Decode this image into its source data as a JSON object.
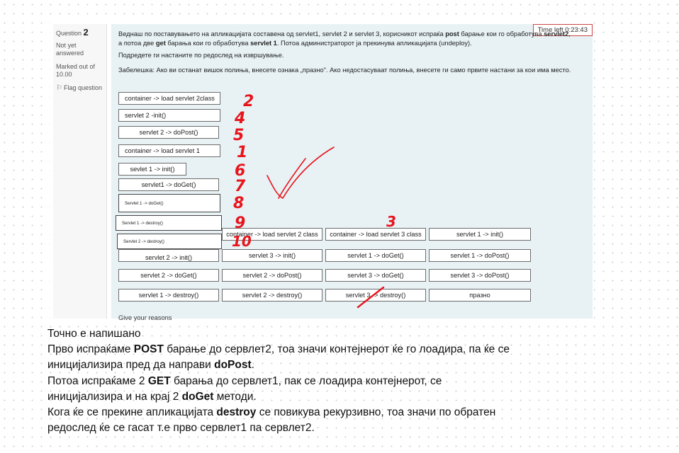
{
  "question": {
    "label": "Question",
    "number": "2",
    "status": "Not yet answered",
    "marked": "Marked out of 10.00",
    "flag": "Flag question",
    "timer": "Time left 0:23:43",
    "text1_a": "Веднаш по поставувањето на апликацијата составена од servlet1, servlet 2 и servlet 3, корисникот испраќа ",
    "text1_b": "post",
    "text1_c": " барање кои го обработува ",
    "text1_d": "servlet2",
    "text1_e": ", а потоа две ",
    "text1_f": "get",
    "text1_g": " барања кои го обработува ",
    "text1_h": "servlet 1",
    "text1_i": ". Потоа администраторот ја прекинува апликацијата (undeploy).",
    "text2": "Подредете ги настаните по редослед на извршување.",
    "text3": "Забелешка: Ако ви останат вишок полиња, внесете ознака „празно\". Ако недостасуваат полиња, внесете ги само првите настани за кои има место.",
    "give_reasons": "Give your reasons"
  },
  "order_slots": [
    "container -> load servlet 2class",
    "servlet 2 -init()",
    "servlet 2 -> doPost()",
    "container -> load servlet 1",
    "sevlet 1 -> init()",
    "servlet1 -> doGet()",
    "Servlet 1 -> doGet()",
    "Servlet 1 -> destroy()",
    "Servlet 2 -> destroy()"
  ],
  "choices": {
    "row1": [
      "container -> load servlet 2 class",
      "container -> load servlet 3 class",
      "servlet 1 -> init()"
    ],
    "row2": [
      "servlet 2 -> init()",
      "servlet 3 -> init()",
      "servlet 1 -> doGet()",
      "servlet 1 -> doPost()"
    ],
    "row3": [
      "servlet 2 -> doGet()",
      "servlet 2 -> doPost()",
      "servlet 3 -> doGet()",
      "servlet 3 -> doPost()"
    ],
    "row4": [
      "servlet 1 -> destroy()",
      "servlet 2 -> destroy()",
      "servlet 3 -> destroy()",
      "празно"
    ]
  },
  "handwritten_numbers": [
    "2",
    "4",
    "5",
    "1",
    "6",
    "7",
    "8",
    "9",
    "10",
    "3"
  ],
  "answer": {
    "l1": "Точно е напишано",
    "l2_a": "Прво испраќаме ",
    "l2_b": "POST",
    "l2_c": " барање до сервлет2, тоа значи контејнерот ќе го лоадира, па ќе се",
    "l3_a": "иницијализира пред да направи ",
    "l3_b": "doPost",
    "l3_c": ".",
    "l4_a": "Потоа испраќаме 2 ",
    "l4_b": "GET",
    "l4_c": " барања до сервлет1, пак се лоадира контејнерот, се",
    "l5_a": "иницијализира и на крај 2 ",
    "l5_b": "doGet",
    "l5_c": " методи.",
    "l6_a": "Кога ќе се прекине апликацијата ",
    "l6_b": "destroy",
    "l6_c": " се повикува рекурзивно, тоа значи по обратен",
    "l7": "редослед ќе се гасат т.е прво сервлет1 па сервлет2."
  },
  "colors": {
    "ink": "#e8141c",
    "panel": "#e8f2f5",
    "timer_border": "#cc4444"
  }
}
